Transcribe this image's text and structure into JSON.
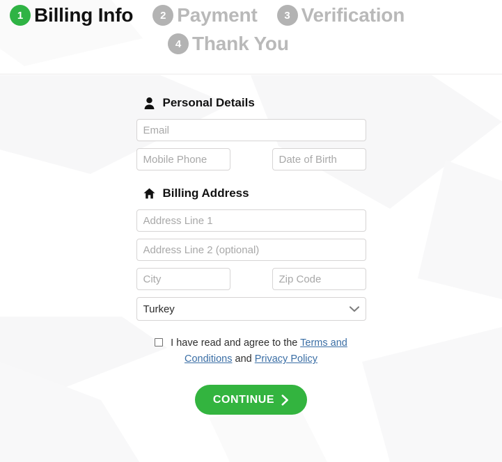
{
  "theme": {
    "accent_green": "#33b43f",
    "badge_active_green": "#2fb344",
    "badge_inactive_gray": "#b3b3b3",
    "inactive_text_gray": "#b9b9b9",
    "link_blue": "#3a6ea5",
    "border_gray": "#d6d4d4",
    "placeholder_gray": "#a8a8a8",
    "page_bg": "#ffffff"
  },
  "steps": [
    {
      "number": "1",
      "label": "Billing Info",
      "state": "active"
    },
    {
      "number": "2",
      "label": "Payment",
      "state": "inactive"
    },
    {
      "number": "3",
      "label": "Verification",
      "state": "inactive"
    },
    {
      "number": "4",
      "label": "Thank You",
      "state": "inactive"
    }
  ],
  "personal_details": {
    "icon": "person-icon",
    "title": "Personal Details",
    "email_placeholder": "Email",
    "email_value": "",
    "mobile_placeholder": "Mobile Phone",
    "mobile_value": "",
    "dob_placeholder": "Date of Birth",
    "dob_value": ""
  },
  "billing_address": {
    "icon": "home-icon",
    "title": "Billing Address",
    "address1_placeholder": "Address Line 1",
    "address1_value": "",
    "address2_placeholder": "Address Line 2 (optional)",
    "address2_value": "",
    "city_placeholder": "City",
    "city_value": "",
    "zip_placeholder": "Zip Code",
    "zip_value": "",
    "country_selected": "Turkey",
    "country_options": [
      "Turkey"
    ],
    "dropdown_icon": "chevron-down-icon"
  },
  "terms": {
    "checked": false,
    "text_before": "I have read and agree to the",
    "terms_link": "Terms and Conditions",
    "conjunction": "and",
    "privacy_link": "Privacy Policy"
  },
  "continue": {
    "label": "CONTINUE",
    "icon": "chevron-right-icon"
  }
}
